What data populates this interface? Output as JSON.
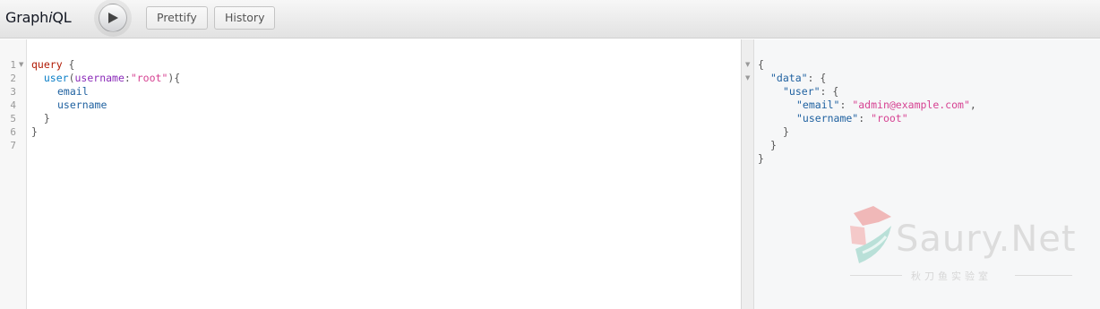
{
  "toolbar": {
    "title_prefix": "Graph",
    "title_italic": "i",
    "title_suffix": "QL",
    "prettify_label": "Prettify",
    "history_label": "History"
  },
  "editor": {
    "line_numbers": [
      "1",
      "2",
      "3",
      "4",
      "5",
      "6",
      "7"
    ],
    "lines": {
      "l1_kw": "query",
      "l1_brace": " {",
      "l2_indent": "  ",
      "l2_fn": "user",
      "l2_open": "(",
      "l2_arg": "username",
      "l2_colon": ":",
      "l2_val": "\"root\"",
      "l2_close": "){",
      "l3": "email",
      "l4": "username",
      "l5": "  }",
      "l6": "}"
    }
  },
  "result": {
    "open": "{",
    "data_key": "\"data\"",
    "user_key": "\"user\"",
    "email_key": "\"email\"",
    "email_value": "\"admin@example.com\"",
    "username_key": "\"username\"",
    "username_value": "\"root\"",
    "close_inner": "}",
    "close_data": "}",
    "close": "}"
  },
  "watermark": {
    "text": "Saury.Net",
    "subtext": "秋刀鱼实验室"
  }
}
